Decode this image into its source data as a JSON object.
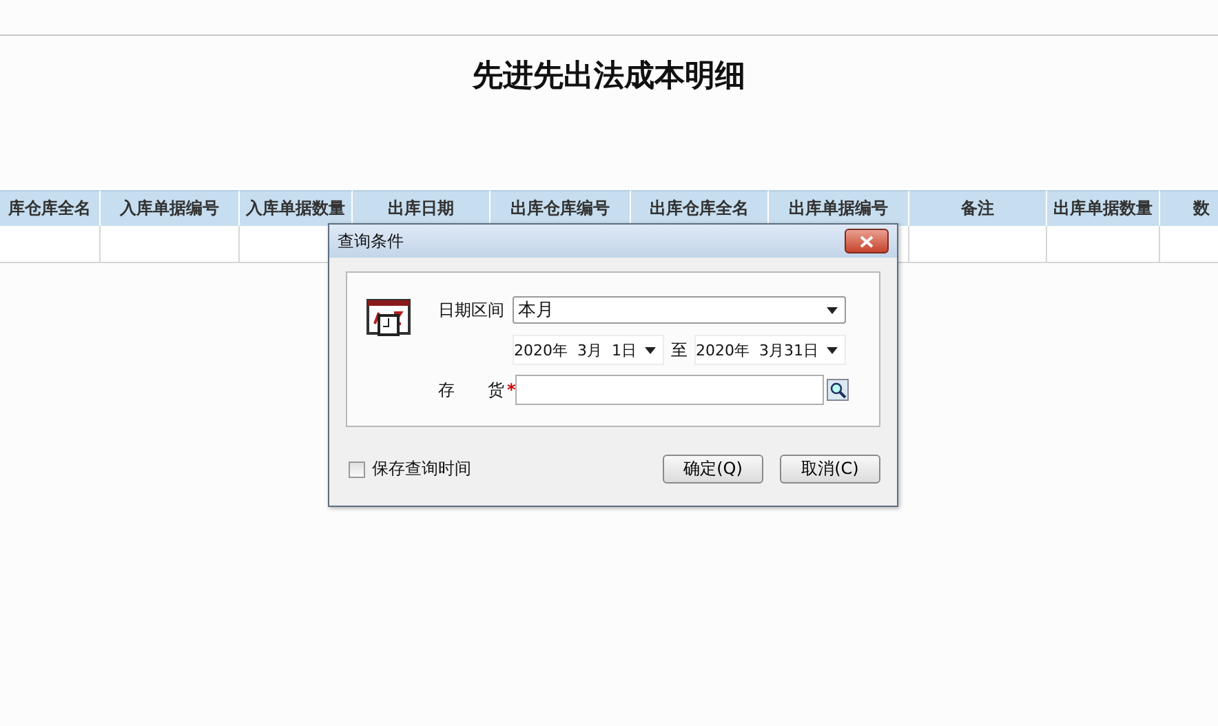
{
  "title": "先进先出法成本明细",
  "table": {
    "columns": [
      "库仓库全名",
      "入库单据编号",
      "入库单据数量",
      "出库日期",
      "出库仓库编号",
      "出库仓库全名",
      "出库单据编号",
      "备注",
      "出库单据数量",
      "数"
    ]
  },
  "dialog": {
    "title": "查询条件",
    "date_range": {
      "label": "日期区间",
      "value": "本月"
    },
    "date_from": "2020年  3月  1日",
    "to_label": "至",
    "date_to": "2020年  3月31日",
    "inventory": {
      "label": "存　　货",
      "required_mark": "*"
    },
    "save_time": {
      "label": "保存查询时间",
      "checked": false
    },
    "buttons": [
      "确定(Q)",
      "取消(C)"
    ]
  }
}
